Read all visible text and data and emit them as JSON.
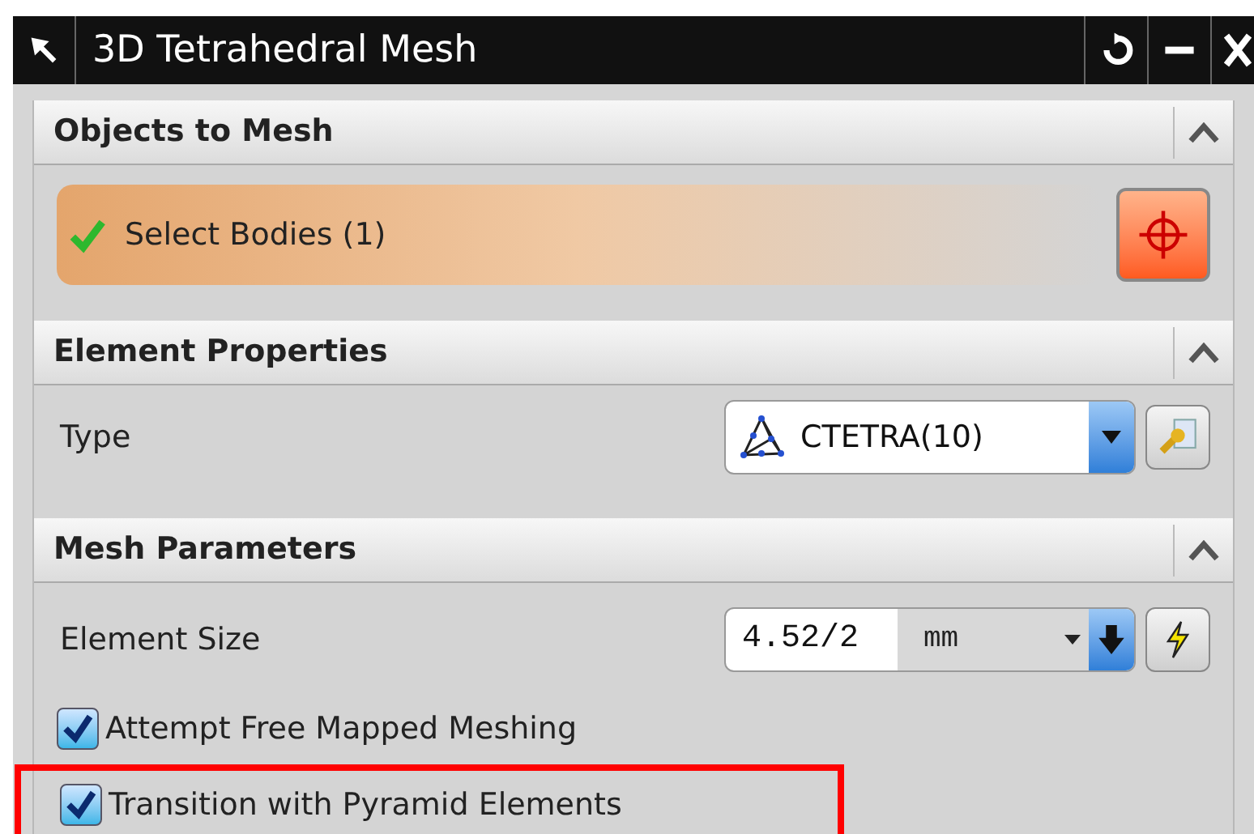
{
  "window": {
    "title": "3D Tetrahedral Mesh"
  },
  "sections": [
    {
      "title": "Objects to Mesh",
      "expanded": true,
      "rows": [
        {
          "kind": "selection",
          "label": "Select Bodies (1)",
          "complete": true
        }
      ]
    },
    {
      "title": "Element Properties",
      "expanded": true,
      "rows": [
        {
          "kind": "dropdown",
          "label": "Type",
          "value": "CTETRA(10)"
        }
      ]
    },
    {
      "title": "Mesh Parameters",
      "expanded": true,
      "rows": [
        {
          "kind": "size",
          "label": "Element Size",
          "value": "4.52/2",
          "unit": "mm"
        },
        {
          "kind": "checkbox",
          "label": "Attempt Free Mapped Meshing",
          "checked": true,
          "highlighted": false
        },
        {
          "kind": "checkbox",
          "label": "Transition with Pyramid Elements",
          "checked": true,
          "highlighted": true
        }
      ]
    }
  ]
}
